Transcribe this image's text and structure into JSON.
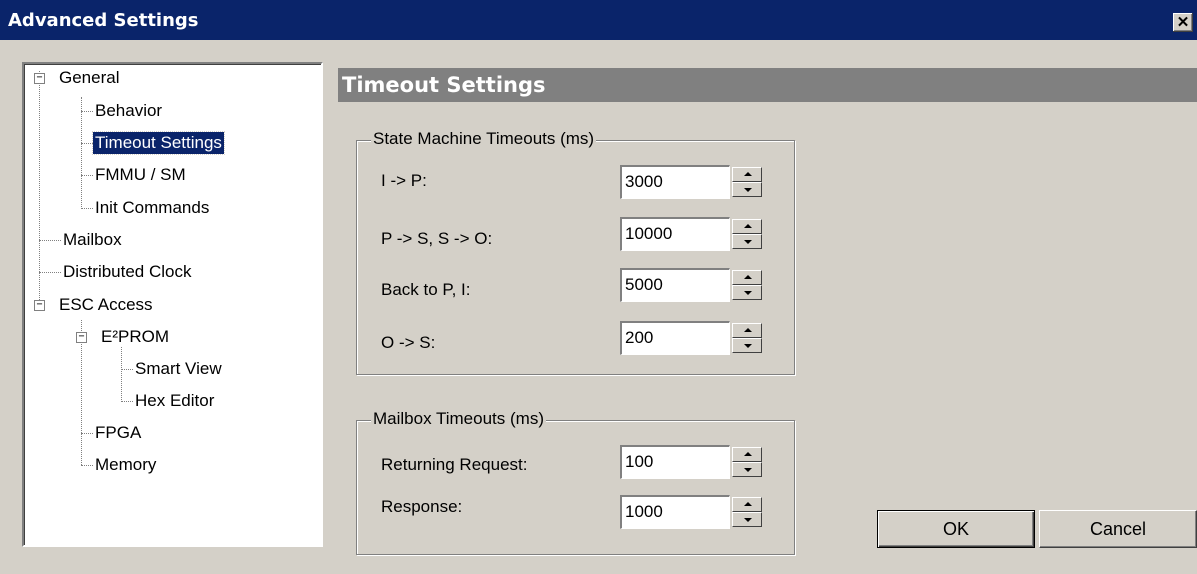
{
  "window": {
    "title": "Advanced Settings",
    "close_label": "✕"
  },
  "tree": {
    "items": [
      {
        "label": "General",
        "toggle": "−"
      },
      {
        "label": "Behavior"
      },
      {
        "label": "Timeout Settings",
        "selected": true
      },
      {
        "label": "FMMU / SM"
      },
      {
        "label": "Init Commands"
      },
      {
        "label": "Mailbox"
      },
      {
        "label": "Distributed Clock"
      },
      {
        "label": "ESC Access",
        "toggle": "−"
      },
      {
        "label": "E²PROM",
        "toggle": "−"
      },
      {
        "label": "Smart View"
      },
      {
        "label": "Hex Editor"
      },
      {
        "label": "FPGA"
      },
      {
        "label": "Memory"
      }
    ]
  },
  "panel": {
    "title": "Timeout Settings"
  },
  "state_machine": {
    "legend": "State Machine Timeouts (ms)",
    "rows": [
      {
        "label": "I -> P:",
        "value": "3000"
      },
      {
        "label": "P -> S,  S -> O:",
        "value": "10000"
      },
      {
        "label": "Back to P, I:",
        "value": "5000"
      },
      {
        "label": "O -> S:",
        "value": "200"
      }
    ]
  },
  "mailbox": {
    "legend": "Mailbox Timeouts (ms)",
    "rows": [
      {
        "label": "Returning Request:",
        "value": "100"
      },
      {
        "label": "Response:",
        "value": "1000"
      }
    ]
  },
  "buttons": {
    "ok": "OK",
    "cancel": "Cancel"
  }
}
